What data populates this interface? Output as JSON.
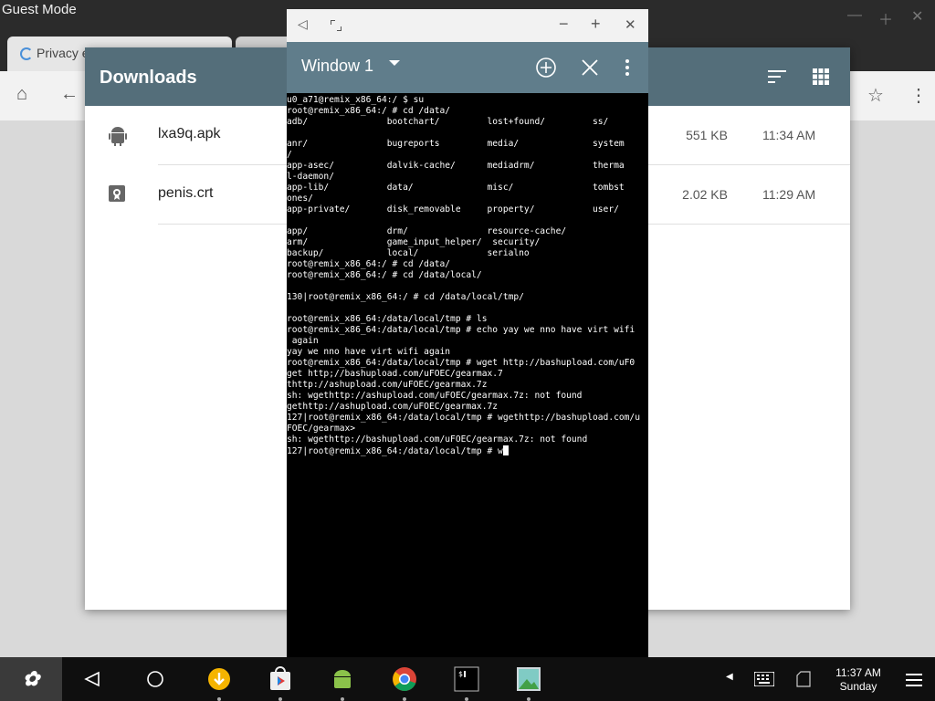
{
  "chrome": {
    "window_title": "Guest Mode",
    "tab_label": "Privacy e"
  },
  "downloads": {
    "title": "Downloads",
    "items": [
      {
        "name": "lxa9q.apk",
        "size": "551 KB",
        "time": "11:34 AM",
        "icon": "android-icon"
      },
      {
        "name": "penis.crt",
        "size": "2.02 KB",
        "time": "11:29 AM",
        "icon": "certificate-icon"
      }
    ]
  },
  "terminal": {
    "window_label": "Window 1",
    "lines": [
      "u0_a71@remix_x86_64:/ $ su",
      "root@remix_x86_64:/ # cd /data/",
      "adb/               bootchart/         lost+found/         ss/",
      "",
      "anr/               bugreports         media/              system",
      "/",
      "app-asec/          dalvik-cache/      mediadrm/           therma",
      "l-daemon/",
      "app-lib/           data/              misc/               tombst",
      "ones/",
      "app-private/       disk_removable     property/           user/",
      "",
      "app/               drm/               resource-cache/",
      "arm/               game_input_helper/  security/",
      "backup/            local/             serialno",
      "root@remix_x86_64:/ # cd /data/",
      "root@remix_x86_64:/ # cd /data/local/",
      "",
      "130|root@remix_x86_64:/ # cd /data/local/tmp/",
      "",
      "root@remix_x86_64:/data/local/tmp # ls",
      "root@remix_x86_64:/data/local/tmp # echo yay we nno have virt wifi",
      " again",
      "yay we nno have virt wifi again",
      "root@remix_x86_64:/data/local/tmp # wget http://bashupload.com/uF0",
      "get http;//bashupload.com/uFOEC/gearmax.7",
      "thttp://ashupload.com/uFOEC/gearmax.7z",
      "sh: wgethttp://ashupload.com/uFOEC/gearmax.7z: not found",
      "gethttp://ashupload.com/uFOEC/gearmax.7z",
      "127|root@remix_x86_64:/data/local/tmp # wgethttp://bashupload.com/u",
      "FOEC/gearmax>",
      "sh: wgethttp://bashupload.com/uFOEC/gearmax.7z: not found",
      "127|root@remix_x86_64:/data/local/tmp # w"
    ]
  },
  "taskbar": {
    "time": "11:37 AM",
    "day": "Sunday"
  }
}
